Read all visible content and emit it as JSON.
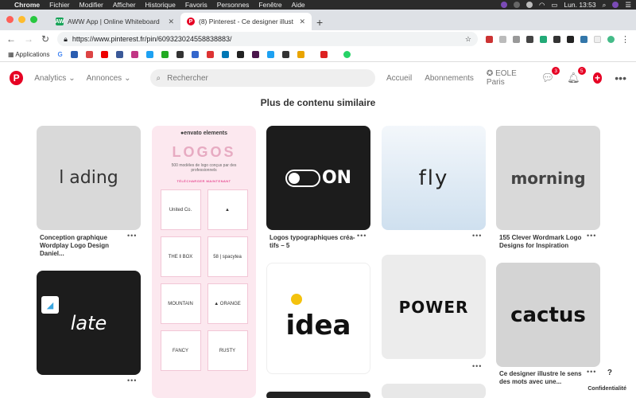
{
  "os_menu": {
    "apple": "",
    "items": [
      "Chrome",
      "Fichier",
      "Modifier",
      "Afficher",
      "Historique",
      "Favoris",
      "Personnes",
      "Fenêtre",
      "Aide"
    ],
    "clock": "Lun. 13:53"
  },
  "tabs": [
    {
      "title": "AWW App | Online Whiteboard",
      "favicon_color": "#19a45a",
      "favicon_text": "AW"
    },
    {
      "title": "(8) Pinterest - Ce designer illust",
      "favicon_color": "#e60023",
      "favicon_text": "P"
    }
  ],
  "toolbar": {
    "url": "https://www.pinterest.fr/pin/609323024558838883/"
  },
  "bookmarks": {
    "apps_label": "Applications"
  },
  "pinterest_header": {
    "analytics": "Analytics",
    "annonces": "Annonces",
    "search_placeholder": "Rechercher",
    "accueil": "Accueil",
    "abonnements": "Abonnements",
    "profile": "EOLE Paris",
    "messages_badge": "3",
    "notifications_badge": "5",
    "accent": "#e60023"
  },
  "section_title": "Plus de contenu similaire",
  "pins": {
    "loading": {
      "word": "l ading",
      "caption": "Conception graphique Wordplay Logo Design Daniel..."
    },
    "envato": {
      "brand": "●envato elements",
      "title": "LOGOS",
      "subtitle": "500 modèles de logo conçus par des professionnels",
      "cta": "TÉLÉCHARGER MAINTENANT",
      "cells": [
        "United Co.",
        "▲",
        "THE ǁ BOX",
        "58 | spacytea",
        "MOUNTAIN",
        "▲ ORANGE",
        "FANCY",
        "RUSTY"
      ]
    },
    "on": {
      "word": "ON",
      "caption": "Logos typographiques créa- tifs – 5"
    },
    "fly": {
      "word": "fly"
    },
    "morning": {
      "word": "morning",
      "caption": "155 Clever Wordmark Logo Designs for Inspiration"
    },
    "late": {
      "word": "late"
    },
    "idea": {
      "word": "idea"
    },
    "power": {
      "word": "POWER"
    },
    "cactus": {
      "word": "cactus",
      "caption": "Ce designer illustre le sens des mots avec une..."
    }
  },
  "privacy": "Confidentialité",
  "help": "?"
}
